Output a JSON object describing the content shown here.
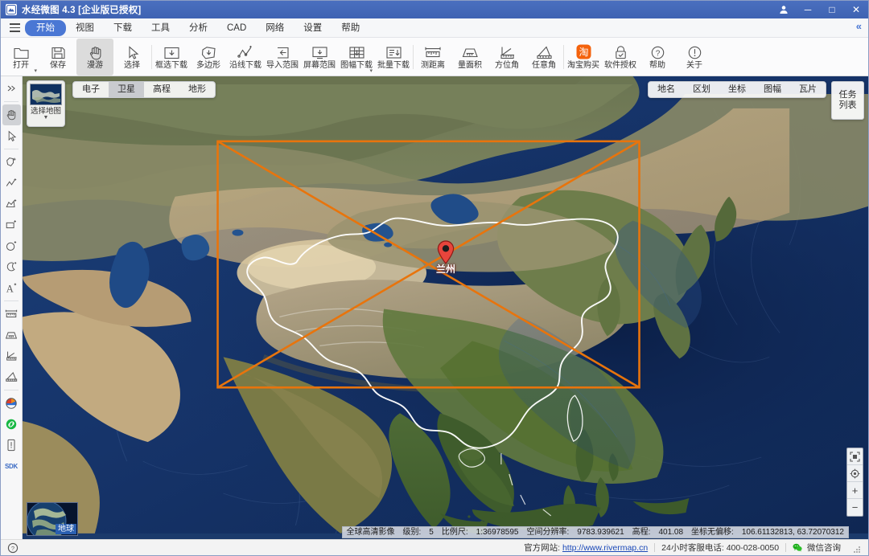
{
  "window": {
    "title": "水经微图 4.3 [企业版已授权]",
    "logo_icon": "mountain-logo-icon",
    "account_icon": "user-account-icon",
    "minimize_label": "─",
    "maximize_label": "□",
    "close_label": "✕"
  },
  "menubar": {
    "hamburger_icon": "hamburger-menu-icon",
    "items": [
      {
        "label": "开始",
        "active": true
      },
      {
        "label": "视图",
        "active": false
      },
      {
        "label": "下载",
        "active": false
      },
      {
        "label": "工具",
        "active": false
      },
      {
        "label": "分析",
        "active": false
      },
      {
        "label": "CAD",
        "active": false
      },
      {
        "label": "网络",
        "active": false
      },
      {
        "label": "设置",
        "active": false
      },
      {
        "label": "帮助",
        "active": false
      }
    ],
    "collapse_label": "«"
  },
  "ribbon": {
    "tools": [
      {
        "label": "打开",
        "icon": "folder-open-icon",
        "dropdown": true,
        "selected": false
      },
      {
        "label": "保存",
        "icon": "floppy-save-icon",
        "dropdown": false,
        "selected": false
      },
      {
        "label": "漫游",
        "icon": "hand-pan-icon",
        "dropdown": false,
        "selected": true
      },
      {
        "label": "选择",
        "icon": "cursor-arrow-icon",
        "dropdown": false,
        "selected": false
      },
      {
        "label": "框选下载",
        "icon": "rect-download-icon",
        "dropdown": false,
        "selected": false
      },
      {
        "label": "多边形",
        "icon": "polygon-download-icon",
        "dropdown": false,
        "selected": false
      },
      {
        "label": "沿线下载",
        "icon": "polyline-download-icon",
        "dropdown": false,
        "selected": false
      },
      {
        "label": "导入范围",
        "icon": "import-range-icon",
        "dropdown": false,
        "selected": false
      },
      {
        "label": "屏幕范围",
        "icon": "screen-range-icon",
        "dropdown": false,
        "selected": false
      },
      {
        "label": "图幅下载",
        "icon": "sheet-download-icon",
        "dropdown": true,
        "selected": false
      },
      {
        "label": "批量下载",
        "icon": "batch-download-icon",
        "dropdown": false,
        "selected": false
      },
      {
        "label": "测距离",
        "icon": "measure-distance-icon",
        "dropdown": false,
        "selected": false
      },
      {
        "label": "量面积",
        "icon": "measure-area-icon",
        "dropdown": false,
        "selected": false
      },
      {
        "label": "方位角",
        "icon": "azimuth-icon",
        "dropdown": false,
        "selected": false
      },
      {
        "label": "任意角",
        "icon": "arbitrary-angle-icon",
        "dropdown": false,
        "selected": false
      },
      {
        "label": "淘宝购买",
        "icon": "taobao-buy-icon",
        "dropdown": false,
        "selected": false
      },
      {
        "label": "软件授权",
        "icon": "license-lock-icon",
        "dropdown": false,
        "selected": false
      },
      {
        "label": "帮助",
        "icon": "help-question-icon",
        "dropdown": false,
        "selected": false
      },
      {
        "label": "关于",
        "icon": "about-info-icon",
        "dropdown": false,
        "selected": false
      }
    ]
  },
  "leftbar": {
    "items": [
      {
        "icon": "expand-right-icon",
        "selected": false
      },
      {
        "icon": "hand-pan-icon",
        "selected": true
      },
      {
        "icon": "cursor-arrow-icon",
        "selected": false
      },
      {
        "icon": "add-region-icon",
        "selected": false
      },
      {
        "icon": "add-polyline-icon",
        "selected": false
      },
      {
        "icon": "add-polygon-icon",
        "selected": false
      },
      {
        "icon": "add-rectangle-icon",
        "selected": false
      },
      {
        "icon": "add-circle-icon",
        "selected": false
      },
      {
        "icon": "add-arc-icon",
        "selected": false
      },
      {
        "icon": "add-text-icon",
        "selected": false
      },
      {
        "icon": "measure-distance-icon",
        "selected": false
      },
      {
        "icon": "measure-area-icon",
        "selected": false
      },
      {
        "icon": "azimuth-icon",
        "selected": false
      },
      {
        "icon": "arbitrary-angle-icon",
        "selected": false
      },
      {
        "icon": "color-palette-icon",
        "selected": false
      },
      {
        "icon": "link-green-icon",
        "selected": false
      },
      {
        "icon": "mobile-device-icon",
        "selected": false
      },
      {
        "icon": "sdk-icon",
        "label": "SDK",
        "selected": false
      }
    ]
  },
  "map": {
    "layer_tabs": [
      {
        "label": "电子",
        "on": false
      },
      {
        "label": "卫星",
        "on": true
      },
      {
        "label": "高程",
        "on": false
      },
      {
        "label": "地形",
        "on": false
      }
    ],
    "overlay_tabs": [
      {
        "label": "地名",
        "on": false
      },
      {
        "label": "区划",
        "on": false
      },
      {
        "label": "坐标",
        "on": false
      },
      {
        "label": "图幅",
        "on": false
      },
      {
        "label": "瓦片",
        "on": false
      }
    ],
    "task_list_label": "任务列表",
    "map_picker_label": "选择地图",
    "globe_label": "地球",
    "marker_label": "兰州",
    "marker_icon": "map-pin-icon",
    "selection_color": "#e8740c",
    "zoom_controls": [
      {
        "icon": "fit-extent-icon",
        "label": ""
      },
      {
        "icon": "center-target-icon",
        "label": ""
      },
      {
        "icon": "zoom-in-icon",
        "label": "+"
      },
      {
        "icon": "zoom-out-icon",
        "label": "−"
      }
    ]
  },
  "statusbar": {
    "image_source": "全球高清影像",
    "level_key": "级别:",
    "level_value": "5",
    "scale_key": "比例尺:",
    "scale_value": "1:36978595",
    "resolution_key": "空间分辨率:",
    "resolution_value": "9783.939621",
    "elevation_key": "高程:",
    "elevation_value": "401.08",
    "offset_key": "坐标无偏移:",
    "coords_value": "106.61132813, 63.72070312",
    "collapse_label": "−"
  },
  "footer": {
    "site_key": "官方网站:",
    "site_url": "http://www.rivermap.cn",
    "phone_key": "24小时客服电话:",
    "phone_value": "400-028-0050",
    "wechat_label": "微信咨询",
    "wechat_icon": "wechat-icon",
    "help_icon": "help-circle-icon"
  }
}
